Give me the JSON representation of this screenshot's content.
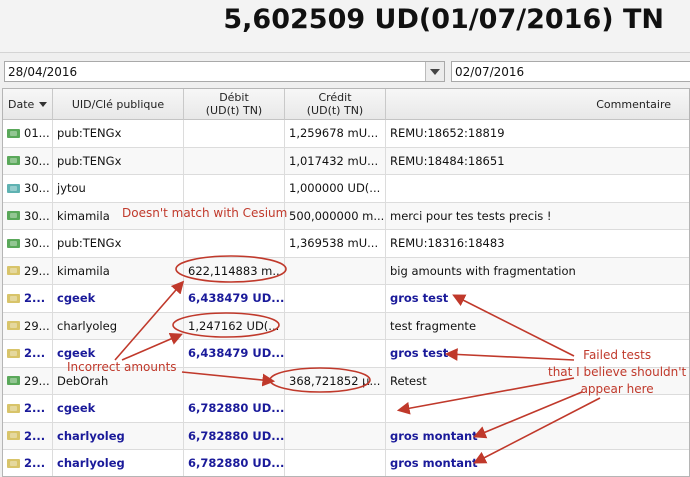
{
  "balance": "5,602509 UD(01/07/2016) TN",
  "date_from": "28/04/2016",
  "date_to": "02/07/2016",
  "columns": {
    "date": "Date",
    "uid": "UID/Clé publique",
    "debit": "Débit\n(UD(t) TN)",
    "credit": "Crédit\n(UD(t) TN)",
    "comment": "Commentaire"
  },
  "rows": [
    {
      "date": "01...",
      "uid": "pub:TENGx",
      "debit": "",
      "credit": "1,259678 mU...",
      "comment": "REMU:18652:18819",
      "icon": "green-transfer-icon",
      "bold": false
    },
    {
      "date": "30...",
      "uid": "pub:TENGx",
      "debit": "",
      "credit": "1,017432 mU...",
      "comment": "REMU:18484:18651",
      "icon": "green-transfer-icon",
      "bold": false
    },
    {
      "date": "30...",
      "uid": "jytou",
      "debit": "",
      "credit": "1,000000 UD(...",
      "comment": "",
      "icon": "teal-transfer-icon",
      "bold": false
    },
    {
      "date": "30...",
      "uid": "kimamila",
      "debit": "",
      "credit": "500,000000 m...",
      "comment": "merci pour tes tests precis !",
      "icon": "green-transfer-icon",
      "bold": false
    },
    {
      "date": "30...",
      "uid": "pub:TENGx",
      "debit": "",
      "credit": "1,369538 mU...",
      "comment": "REMU:18316:18483",
      "icon": "green-transfer-icon",
      "bold": false
    },
    {
      "date": "29...",
      "uid": "kimamila",
      "debit": "622,114883 m...",
      "credit": "",
      "comment": "big amounts with fragmentation",
      "icon": "yellow-transfer-icon",
      "bold": false
    },
    {
      "date": "2...",
      "uid": "cgeek",
      "debit": "6,438479 UD...",
      "credit": "",
      "comment": "gros test",
      "icon": "yellow-transfer-icon",
      "bold": true
    },
    {
      "date": "29...",
      "uid": "charlyoleg",
      "debit": "1,247162 UD(...",
      "credit": "",
      "comment": "test fragmente",
      "icon": "yellow-transfer-icon",
      "bold": false
    },
    {
      "date": "2...",
      "uid": "cgeek",
      "debit": "6,438479 UD...",
      "credit": "",
      "comment": "gros test",
      "icon": "yellow-transfer-icon",
      "bold": true
    },
    {
      "date": "29...",
      "uid": "DebOrah",
      "debit": "",
      "credit": "368,721852 µ...",
      "comment": "Retest",
      "icon": "green-transfer-icon",
      "bold": false
    },
    {
      "date": "2...",
      "uid": "cgeek",
      "debit": "6,782880 UD...",
      "credit": "",
      "comment": "",
      "icon": "yellow-transfer-icon",
      "bold": true
    },
    {
      "date": "2...",
      "uid": "charlyoleg",
      "debit": "6,782880 UD...",
      "credit": "",
      "comment": "gros montant",
      "icon": "yellow-transfer-icon",
      "bold": true
    },
    {
      "date": "2...",
      "uid": "charlyoleg",
      "debit": "6,782880 UD...",
      "credit": "",
      "comment": "gros montant",
      "icon": "yellow-transfer-icon",
      "bold": true
    }
  ],
  "annotations": {
    "cesium": "Doesn't match with Cesium",
    "incorrect": "Incorrect amounts",
    "failed": "Failed tests\nthat I believe shouldn't\nappear here"
  },
  "colors": {
    "annotation": "#c0392b",
    "bold_row_text": "#1a1a9a"
  }
}
